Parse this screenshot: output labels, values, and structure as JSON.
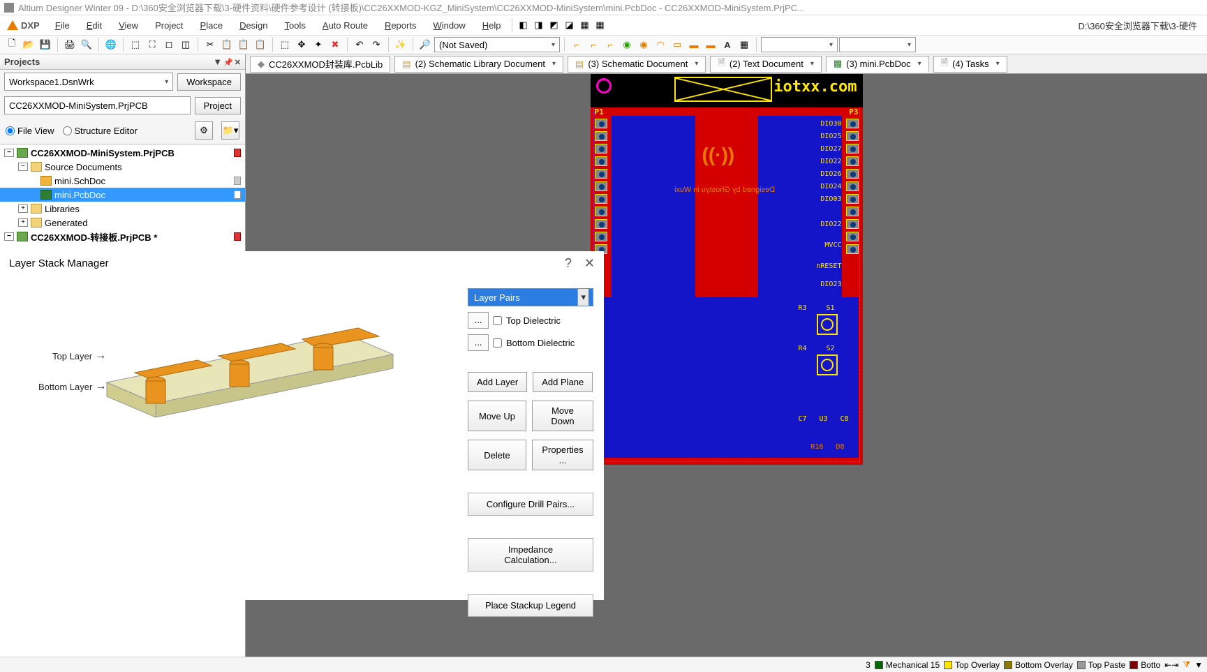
{
  "title": "Altium Designer Winter 09 - D:\\360安全浏览器下载\\3-硬件资料\\硬件参考设计 (转接板)\\CC26XXMOD-KGZ_MiniSystem\\CC26XXMOD-MiniSystem\\mini.PcbDoc - CC26XXMOD-MiniSystem.PrjPC...",
  "menubar": {
    "dxp": "DXP",
    "items": [
      "File",
      "Edit",
      "View",
      "Project",
      "Place",
      "Design",
      "Tools",
      "Auto Route",
      "Reports",
      "Window",
      "Help"
    ]
  },
  "pathbar": "D:\\360安全浏览器下载\\3-硬件",
  "toolbar": {
    "combo": "(Not Saved)"
  },
  "projects": {
    "title": "Projects",
    "workspace": "Workspace1.DsnWrk",
    "workspace_btn": "Workspace",
    "project_name": "CC26XXMOD-MiniSystem.PrjPCB",
    "project_btn": "Project",
    "file_view": "File View",
    "structure_editor": "Structure Editor",
    "tree": {
      "root1": "CC26XXMOD-MiniSystem.PrjPCB",
      "src_docs": "Source Documents",
      "sch": "mini.SchDoc",
      "pcb": "mini.PcbDoc",
      "libs": "Libraries",
      "gen": "Generated",
      "root2": "CC26XXMOD-转接板.PrjPCB *"
    }
  },
  "doctabs": {
    "t1": "CC26XXMOD封装库.PcbLib",
    "t2": "(2) Schematic Library Document",
    "t3": "(3) Schematic Document",
    "t4": "(2) Text Document",
    "t5": "(3) mini.PcbDoc",
    "t6": "(4) Tasks"
  },
  "board": {
    "brand": "iotxx.com",
    "p1": "P1",
    "p3": "P3",
    "right_nets": [
      "DIO30",
      "DIO25",
      "DIO27",
      "DIO22",
      "DIO26",
      "DIO24",
      "DIO03",
      "DIO22",
      "MVCC",
      "nRESET",
      "DIO23"
    ],
    "comps": [
      "R3",
      "S1",
      "R4",
      "S2",
      "C7",
      "U3",
      "C8",
      "R16",
      "D8"
    ],
    "center": "((·))",
    "subtext": "Designed by Ghostyu in Wuxi"
  },
  "statusbar": {
    "s0": "3",
    "s1": "Mechanical 15",
    "s2": "Top Overlay",
    "s3": "Bottom Overlay",
    "s4": "Top Paste",
    "s5": "Botto"
  },
  "layerdlg": {
    "title": "Layer Stack Manager",
    "combo": "Layer Pairs",
    "top_di": "Top Dielectric",
    "bot_di": "Bottom Dielectric",
    "add_layer": "Add Layer",
    "add_plane": "Add Plane",
    "move_up": "Move Up",
    "move_down": "Move Down",
    "delete": "Delete",
    "properties": "Properties ...",
    "drill": "Configure Drill Pairs...",
    "imped": "Impedance Calculation...",
    "legend": "Place Stackup Legend",
    "top_layer": "Top Layer",
    "bottom_layer": "Bottom Layer"
  }
}
